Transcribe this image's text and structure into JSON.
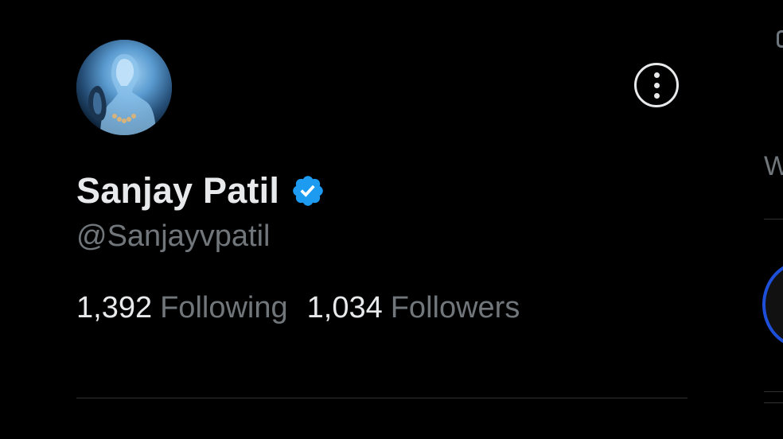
{
  "profile": {
    "display_name": "Sanjay Patil",
    "handle": "@Sanjayvpatil",
    "verified": true,
    "avatar_icon": "profile-avatar"
  },
  "stats": {
    "following_count": "1,392",
    "following_label": "Following",
    "followers_count": "1,034",
    "followers_label": "Followers"
  },
  "actions": {
    "more_icon": "more-options-icon"
  },
  "sidebar_edge": {
    "partial_text": "W"
  },
  "colors": {
    "background": "#000000",
    "primary_text": "#e7e9ea",
    "secondary_text": "#71767b",
    "verified_badge": "#1d9bf0",
    "divider": "#2f3336"
  }
}
